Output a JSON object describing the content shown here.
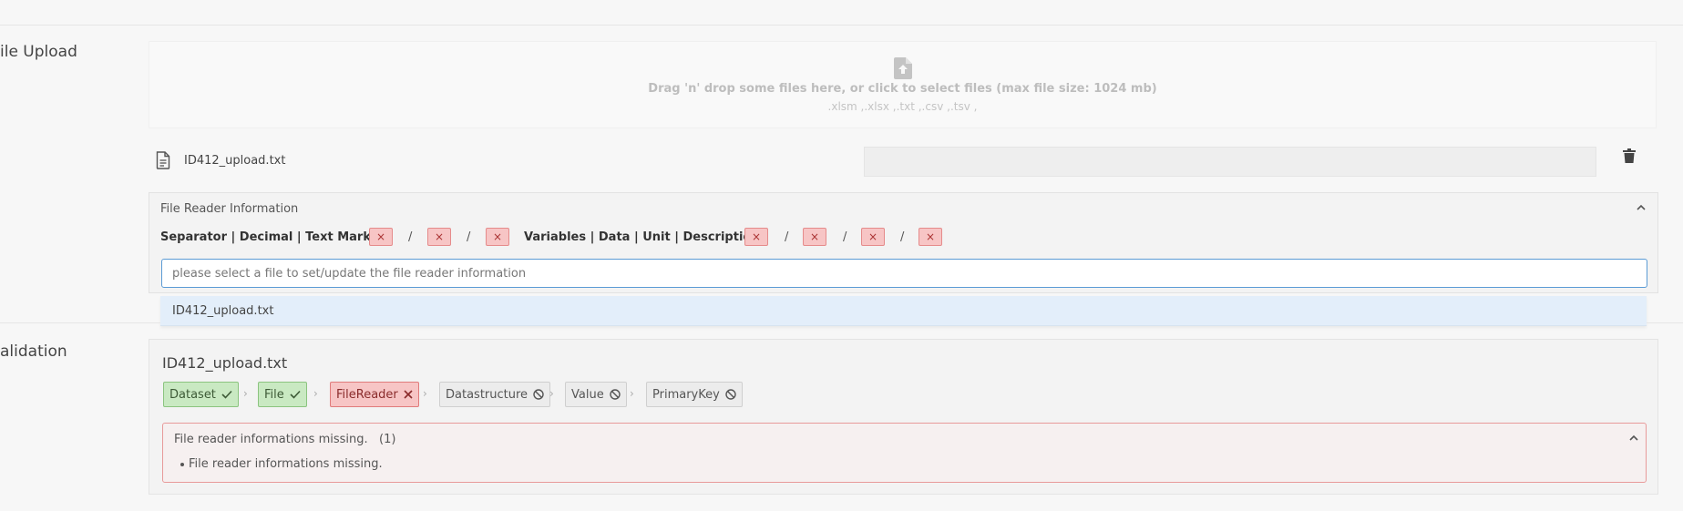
{
  "upload": {
    "section_label": "ile Upload",
    "dropzone_text": "Drag 'n' drop some files here, or click to select files (max file size: 1024 mb)",
    "dropzone_types": ".xlsm ,.xlsx ,.txt ,.csv ,.tsv ,",
    "file_name": "ID412_upload.txt"
  },
  "reader": {
    "title": "File Reader Information",
    "sep_label": "Separator | Decimal | Text Marker :",
    "var_label": "Variables | Data | Unit | Description :",
    "x_glyph": "×",
    "slash": "/",
    "select_placeholder": "please select a file to set/update the file reader information",
    "option": "ID412_upload.txt"
  },
  "validation": {
    "section_label": "alidation",
    "file_title": "ID412_upload.txt",
    "steps": [
      {
        "label": "Dataset",
        "state": "ok"
      },
      {
        "label": "File",
        "state": "ok"
      },
      {
        "label": "FileReader",
        "state": "error"
      },
      {
        "label": "Datastructure",
        "state": "disabled"
      },
      {
        "label": "Value",
        "state": "disabled"
      },
      {
        "label": "PrimaryKey",
        "state": "disabled"
      }
    ],
    "chevron": "›",
    "alert_title": "File reader informations missing.   (1)",
    "alert_item": "File reader informations missing."
  },
  "colors": {
    "ok_bg": "#c9e9c2",
    "error_bg": "#f7c5c5",
    "disabled_bg": "#ececec",
    "focus_border": "#5b9bd5"
  }
}
